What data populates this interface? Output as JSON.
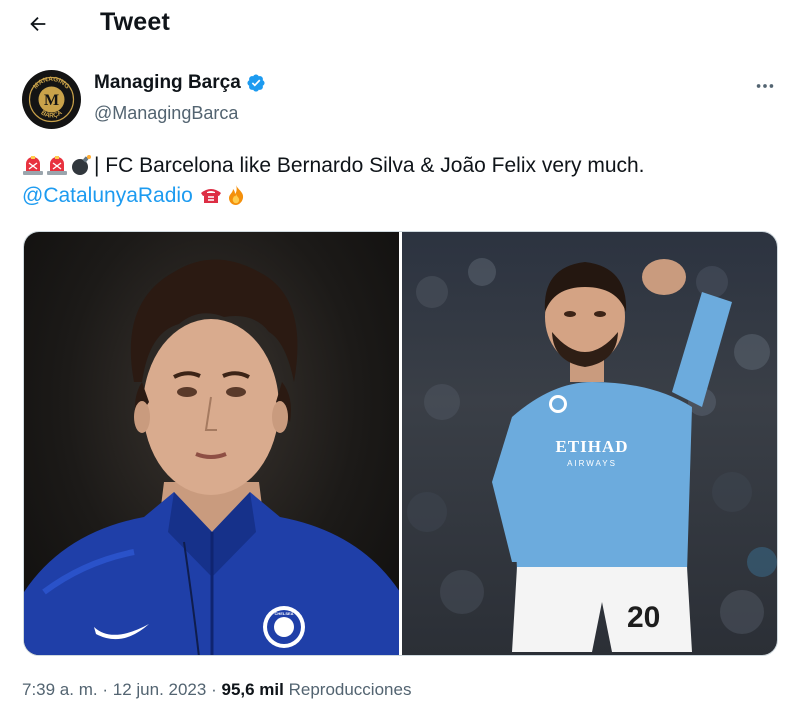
{
  "header": {
    "title": "Tweet"
  },
  "author": {
    "name": "Managing Barça",
    "handle": "@ManagingBarca",
    "verified": true,
    "avatar_text": "MANAGING BARÇA",
    "avatar_initial": "M"
  },
  "tweet": {
    "text": "| FC Barcelona like Bernardo Silva & João Felix very much.",
    "mention": "@CatalunyaRadio",
    "leading_emojis": [
      "police-light-emoji",
      "police-light-emoji",
      "bomb-emoji"
    ],
    "trailing_emojis": [
      "telephone-emoji",
      "fire-emoji"
    ]
  },
  "media": {
    "left_photo": {
      "badge_text": "CHELSEA"
    },
    "right_photo": {
      "sponsor": "ETIHAD",
      "sponsor_sub": "AIRWAYS",
      "shorts_number": "20"
    }
  },
  "meta": {
    "time": "7:39 a. m.",
    "sep1": "·",
    "date": "12 jun. 2023",
    "sep2": "·",
    "views_count": "95,6 mil",
    "views_label": "Reproducciones"
  },
  "colors": {
    "link": "#1d9bf0",
    "verified": "#1d9bf0",
    "muted": "#536471",
    "text": "#0f1419"
  }
}
